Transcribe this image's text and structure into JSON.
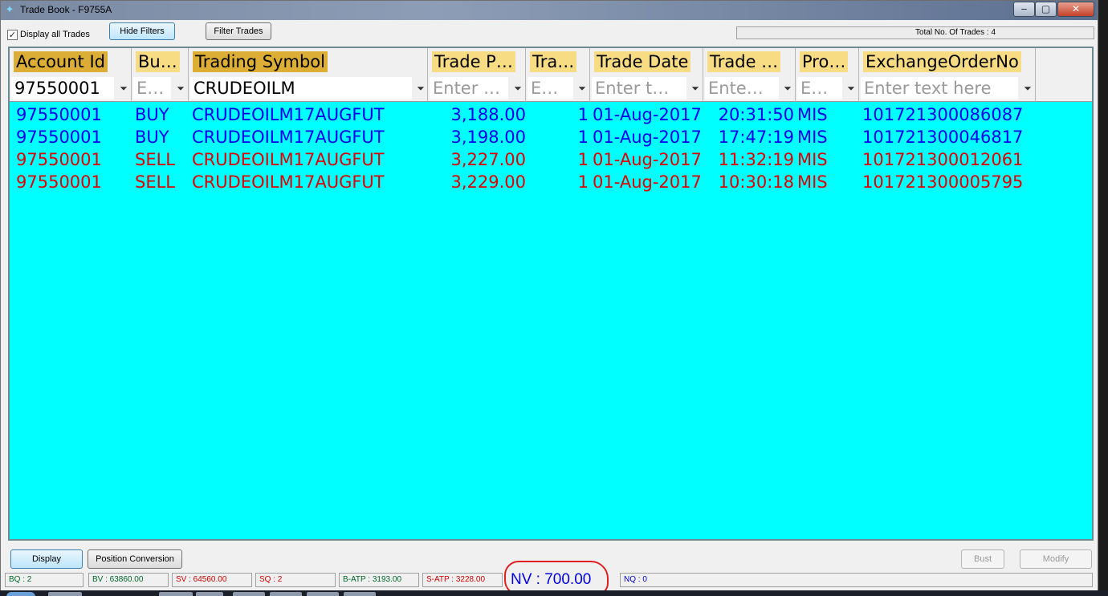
{
  "window": {
    "title": "Trade Book - F9755A",
    "controls": {
      "minimize": "‒",
      "maximize": "▢",
      "close": "✕"
    }
  },
  "toolbar": {
    "display_all_label": "Display all Trades",
    "display_all_checked": true,
    "hide_filters_label": "Hide Filters",
    "filter_trades_label": "Filter Trades",
    "total_trades_text": "Total No. Of Trades : 4"
  },
  "grid": {
    "background": "#00ffff",
    "headers": [
      "Account Id",
      "Bu…",
      "Trading Symbol",
      "Trade P…",
      "Tra…",
      "Trade Date",
      "Trade …",
      "Pro…",
      "ExchangeOrderNo"
    ],
    "filters": {
      "account_id": "97550001",
      "buy_sell_placeholder": "E…",
      "trading_symbol": "CRUDEOILM",
      "trade_price_placeholder": "Enter …",
      "trade_qty_placeholder": "E…",
      "trade_date_placeholder": "Enter t…",
      "trade_time_placeholder": "Ente…",
      "product_placeholder": "E…",
      "exchange_order_placeholder": "Enter text here"
    },
    "rows": [
      {
        "side": "buy",
        "account": "97550001",
        "bs": "BUY",
        "symbol": "CRUDEOILM17AUGFUT",
        "price": "3,188.00",
        "qty": "1",
        "date": "01-Aug-2017",
        "time": "20:31:50",
        "product": "MIS",
        "order_no": "101721300086087"
      },
      {
        "side": "buy",
        "account": "97550001",
        "bs": "BUY",
        "symbol": "CRUDEOILM17AUGFUT",
        "price": "3,198.00",
        "qty": "1",
        "date": "01-Aug-2017",
        "time": "17:47:19",
        "product": "MIS",
        "order_no": "101721300046817"
      },
      {
        "side": "sell",
        "account": "97550001",
        "bs": "SELL",
        "symbol": "CRUDEOILM17AUGFUT",
        "price": "3,227.00",
        "qty": "1",
        "date": "01-Aug-2017",
        "time": "11:32:19",
        "product": "MIS",
        "order_no": "101721300012061"
      },
      {
        "side": "sell",
        "account": "97550001",
        "bs": "SELL",
        "symbol": "CRUDEOILM17AUGFUT",
        "price": "3,229.00",
        "qty": "1",
        "date": "01-Aug-2017",
        "time": "10:30:18",
        "product": "MIS",
        "order_no": "101721300005795"
      }
    ]
  },
  "footer": {
    "display_label": "Display",
    "position_conversion_label": "Position Conversion",
    "bust_label": "Bust",
    "modify_label": "Modify"
  },
  "status_bar": {
    "bq": "BQ : 2",
    "bv": "BV : 63860.00",
    "sv": "SV : 64560.00",
    "sq": "SQ : 2",
    "batp": "B-ATP : 3193.00",
    "satp": "S-ATP : 3228.00",
    "nv": "NV : 700.00",
    "nq": "NQ : 0"
  },
  "colors": {
    "buy": "#0000ee",
    "sell": "#e00000",
    "header": "#f7dc84",
    "sorted_header": "#dcae36",
    "annotation": "#e02020"
  }
}
